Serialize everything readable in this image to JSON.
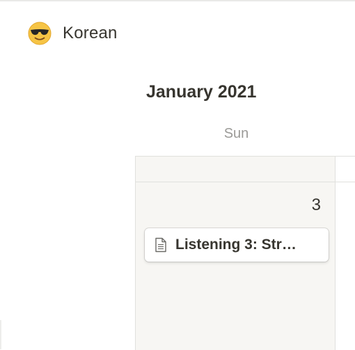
{
  "page": {
    "icon": "sunglasses-face-emoji",
    "title": "Korean"
  },
  "calendar": {
    "month_label": "January 2021",
    "weekday": "Sun",
    "day_number": "3",
    "events": [
      {
        "icon": "document-icon",
        "title": "Listening 3: Str…"
      }
    ]
  },
  "colors": {
    "text": "#37352f",
    "muted": "#9b9a97",
    "day_bg": "#f7f6f3",
    "grid_line": "#e0e0dd"
  }
}
